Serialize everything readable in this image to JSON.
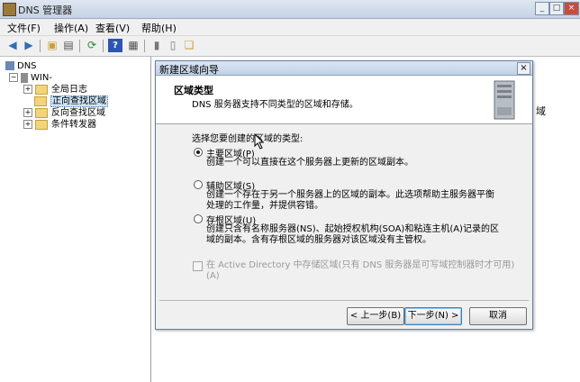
{
  "window": {
    "title": "DNS 管理器",
    "controls": [
      "_",
      "□",
      "×"
    ]
  },
  "menubar": [
    "文件(F)",
    "操作(A)",
    "查看(V)",
    "帮助(H)"
  ],
  "toolbar_icons": [
    "back-arrow-icon",
    "forward-arrow-icon",
    "folder-up-icon",
    "view-icon",
    "refresh-icon",
    "help-icon",
    "properties-icon",
    "server-icon",
    "record-icon",
    "zone-icon"
  ],
  "tree": {
    "root": "DNS",
    "server": "WIN-",
    "items": [
      {
        "label": "全局日志",
        "expander": "+"
      },
      {
        "label": "正向查找区域",
        "expander": ""
      },
      {
        "label": "反向查找区域",
        "expander": "+"
      },
      {
        "label": "条件转发器",
        "expander": "+"
      }
    ]
  },
  "right_pane_fragment": "域",
  "dialog": {
    "title": "新建区域向导",
    "close": "×",
    "heading": "区域类型",
    "description": "DNS 服务器支持不同类型的区域和存储。",
    "prompt": "选择您要创建的区域的类型:",
    "options": [
      {
        "label": "主要区域(P)",
        "selected": true,
        "desc": [
          "创建一个可以直接在这个服务器上更新的区域副本。"
        ]
      },
      {
        "label": "辅助区域(S)",
        "selected": false,
        "desc": [
          "创建一个存在于另一个服务器上的区域的副本。此选项帮助主服务器平衡",
          "处理的工作量，并提供容错。"
        ]
      },
      {
        "label": "存根区域(U)",
        "selected": false,
        "desc": [
          "创建只含有名称服务器(NS)、起始授权机构(SOA)和粘连主机(A)记录的区",
          "域的副本。含有存根区域的服务器对该区域没有主管权。"
        ]
      }
    ],
    "ad_checkbox": {
      "line1": "在 Active Directory 中存储区域(只有 DNS 服务器是可写域控制器时才可用)",
      "line2": "(A)",
      "checked": false,
      "enabled": false
    },
    "buttons": {
      "back": "< 上一步(B)",
      "next": "下一步(N) >",
      "cancel": "取消"
    }
  }
}
